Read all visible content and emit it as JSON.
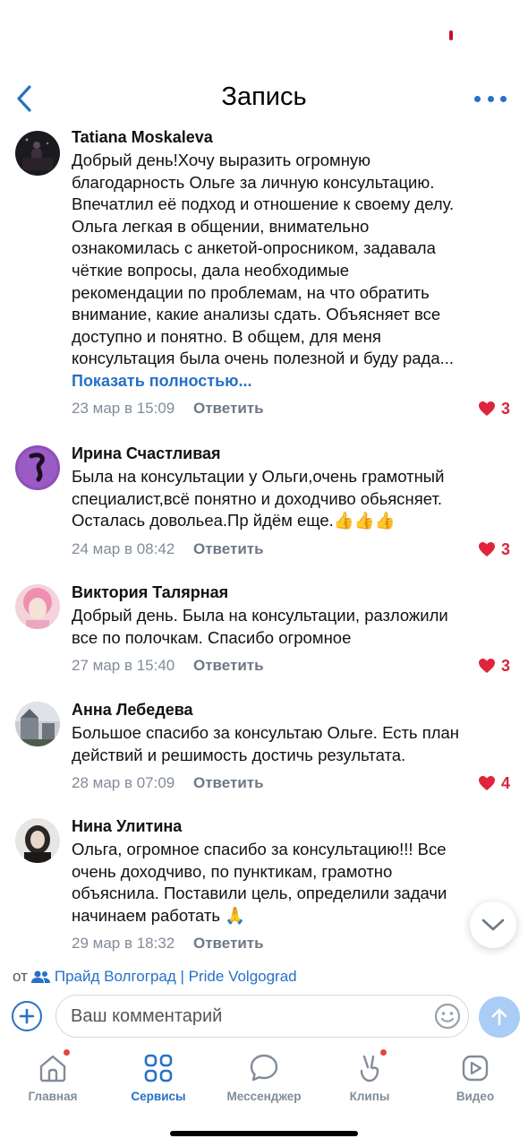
{
  "header": {
    "title": "Запись"
  },
  "comments": [
    {
      "author": "Tatiana Moskaleva",
      "text_lines": [
        "Добрый день!Хочу выразить огромную",
        "благодарность Ольге за личную консультацию.",
        "Впечатлил её подход и отношение к своему делу.",
        "Ольга легкая в общении, внимательно",
        "ознакомилась с анкетой-опросником, задавала",
        "чёткие вопросы, дала необходимые",
        "рекомендации по проблемам, на что обратить",
        "внимание, какие анализы сдать. Объясняет все",
        "доступно и понятно. В общем, для меня",
        "консультация была очень полезной и буду рада..."
      ],
      "show_more": "Показать полностью...",
      "time": "23 мар в 15:09",
      "reply": "Ответить",
      "likes": "3"
    },
    {
      "author": "Ирина Счастливая",
      "text_lines": [
        "Была на консультации у Ольги,очень грамотный",
        "специалист,всё понятно и доходчиво обьясняет.",
        "Осталась довольеа.Пр йдём еще.👍👍👍"
      ],
      "time": "24 мар в 08:42",
      "reply": "Ответить",
      "likes": "3"
    },
    {
      "author": "Виктория Талярная",
      "text_lines": [
        "Добрый день. Была на консультации, разложили",
        "все по полочкам. Спасибо огромное"
      ],
      "time": "27 мар в 15:40",
      "reply": "Ответить",
      "likes": "3"
    },
    {
      "author": "Анна Лебедева",
      "text_lines": [
        "Большое спасибо за консультаю Ольге. Есть план",
        "действий и решимость достичь результата."
      ],
      "time": "28 мар в 07:09",
      "reply": "Ответить",
      "likes": "4"
    },
    {
      "author": "Нина Улитина",
      "text_lines": [
        "Ольга, огромное спасибо за консультацию!!! Все",
        "очень доходчиво, по пунктикам, грамотно",
        "объяснила. Поставили цель, определили задачи",
        "начинаем работать 🙏"
      ],
      "time": "29 мар в 18:32",
      "reply": "Ответить"
    }
  ],
  "source": {
    "prefix": "от",
    "group": "Прайд Волгоград | Pride Volgograd"
  },
  "composer": {
    "placeholder": "Ваш комментарий"
  },
  "tabs": [
    {
      "label": "Главная",
      "icon": "home-icon",
      "badge": true
    },
    {
      "label": "Сервисы",
      "icon": "services-icon",
      "active": true
    },
    {
      "label": "Мессенджер",
      "icon": "messenger-icon"
    },
    {
      "label": "Клипы",
      "icon": "clips-icon",
      "badge": true
    },
    {
      "label": "Видео",
      "icon": "video-icon"
    }
  ],
  "colors": {
    "accent": "#2671c7",
    "like": "#d7263d",
    "secondary_text": "#818c99"
  }
}
